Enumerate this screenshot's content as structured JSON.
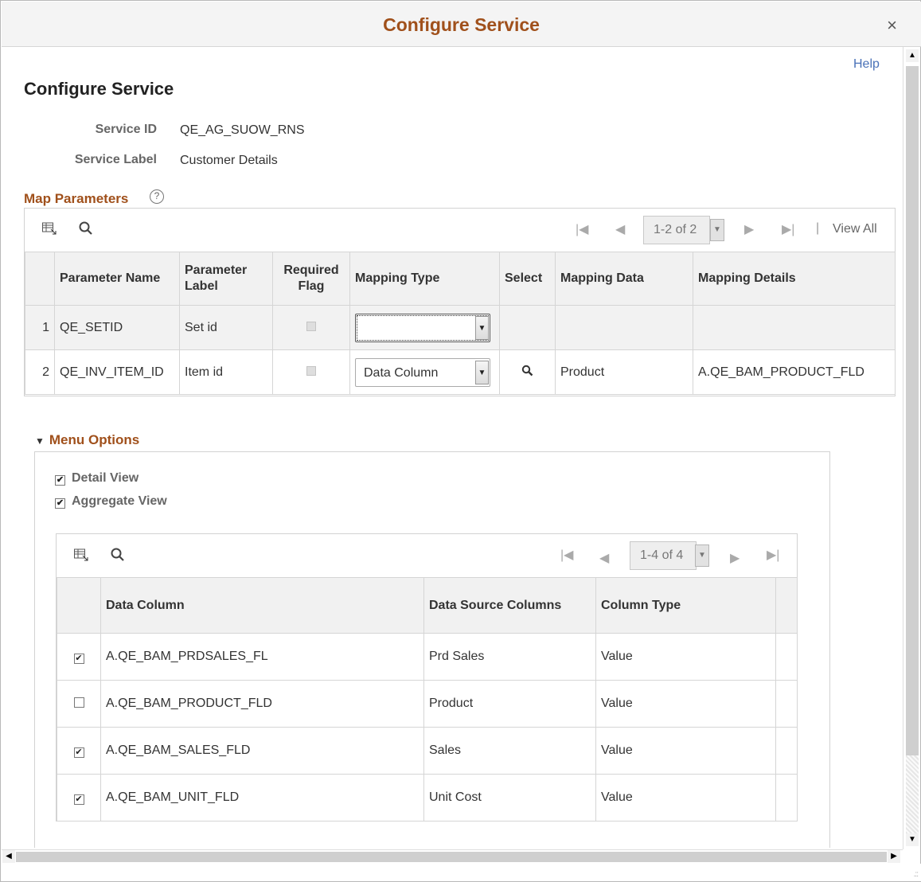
{
  "dialog": {
    "title": "Configure Service",
    "close_icon": "×"
  },
  "page": {
    "help_link": "Help",
    "title": "Configure Service"
  },
  "fields": {
    "service_id_label": "Service ID",
    "service_id_value": "QE_AG_SUOW_RNS",
    "service_label_label": "Service Label",
    "service_label_value": "Customer Details"
  },
  "map_parameters": {
    "title": "Map Parameters",
    "help_icon": "?",
    "pager": {
      "first": "|◀",
      "prev": "◀",
      "range": "1-2 of 2",
      "next": "▶",
      "last": "▶|",
      "separator": "|",
      "view_all": "View All"
    },
    "columns": [
      "Parameter Name",
      "Parameter Label",
      "Required Flag",
      "Mapping Type",
      "Select",
      "Mapping Data",
      "Mapping Details"
    ],
    "rows": [
      {
        "num": "1",
        "name": "QE_SETID",
        "label": "Set id",
        "mapping_type": "",
        "mapping_data": "",
        "mapping_details": ""
      },
      {
        "num": "2",
        "name": "QE_INV_ITEM_ID",
        "label": "Item id",
        "mapping_type": "Data Column",
        "mapping_data": "Product",
        "mapping_details": "A.QE_BAM_PRODUCT_FLD"
      }
    ]
  },
  "menu_options": {
    "title": "Menu Options",
    "detail_view": {
      "label": "Detail View",
      "checked": true
    },
    "aggregate_view": {
      "label": "Aggregate View",
      "checked": true
    },
    "pager": {
      "first": "|◀",
      "prev": "◀",
      "range": "1-4 of 4",
      "next": "▶",
      "last": "▶|"
    },
    "columns": [
      "Data Column",
      "Data Source Columns",
      "Column Type"
    ],
    "rows": [
      {
        "checked": true,
        "data_column": "A.QE_BAM_PRDSALES_FL",
        "source": "Prd Sales",
        "type": "Value"
      },
      {
        "checked": false,
        "data_column": "A.QE_BAM_PRODUCT_FLD",
        "source": "Product",
        "type": "Value"
      },
      {
        "checked": true,
        "data_column": "A.QE_BAM_SALES_FLD",
        "source": "Sales",
        "type": "Value"
      },
      {
        "checked": true,
        "data_column": "A.QE_BAM_UNIT_FLD",
        "source": "Unit Cost",
        "type": "Value"
      }
    ]
  },
  "icons": {
    "personalize": "grid-personalize-icon",
    "search": "search-icon",
    "lookup": "magnifier-icon",
    "checkmark": "✔"
  }
}
